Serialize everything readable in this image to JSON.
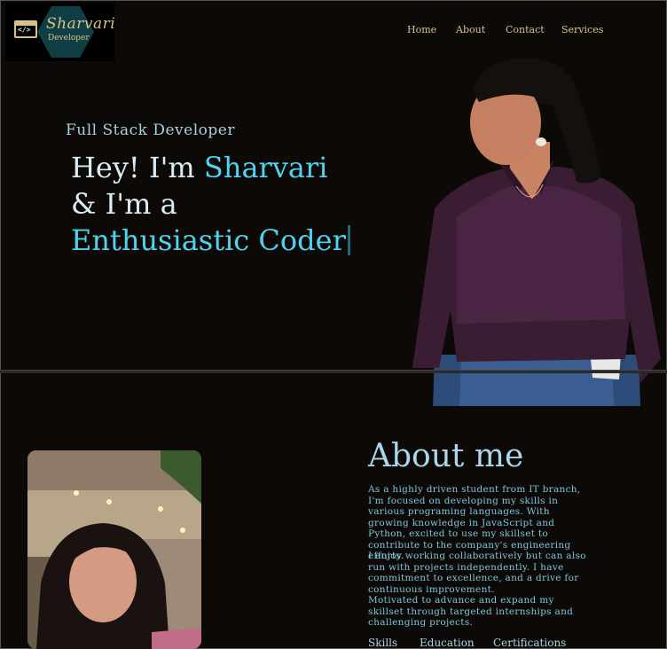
{
  "logo": {
    "name": "Sharvari",
    "sub": "Developer",
    "code_glyph": "</>"
  },
  "nav": {
    "home": "Home",
    "about": "About",
    "contact": "Contact",
    "services": "Services"
  },
  "hero": {
    "subtitle": "Full Stack Developer",
    "line1_prefix": "Hey! I'm ",
    "line1_name": "Sharvari",
    "line2": "& I'm a",
    "line3": "Enthusiastic Coder"
  },
  "about": {
    "title": "About me",
    "para1": "As a highly driven student from IT branch, I'm focused on developing my skills in various programing languages. With growing knowledge in JavaScript and Python, excited to use my skillset to contribute to the company's engineering efforts.",
    "para2": "I enjoy working collaboratively but can also run with projects independently. I have commitment to excellence, and a drive for continuous improvement.",
    "para3": "Motivated to advance and expand my skillset through targeted internships and challenging projects.",
    "links": {
      "skills": "Skills",
      "education": "Education",
      "certifications": "Certifications"
    }
  },
  "colors": {
    "background": "#0c0906",
    "accent": "#4fd4f0",
    "nav": "#d8c28a",
    "text": "#d9ecf3"
  }
}
